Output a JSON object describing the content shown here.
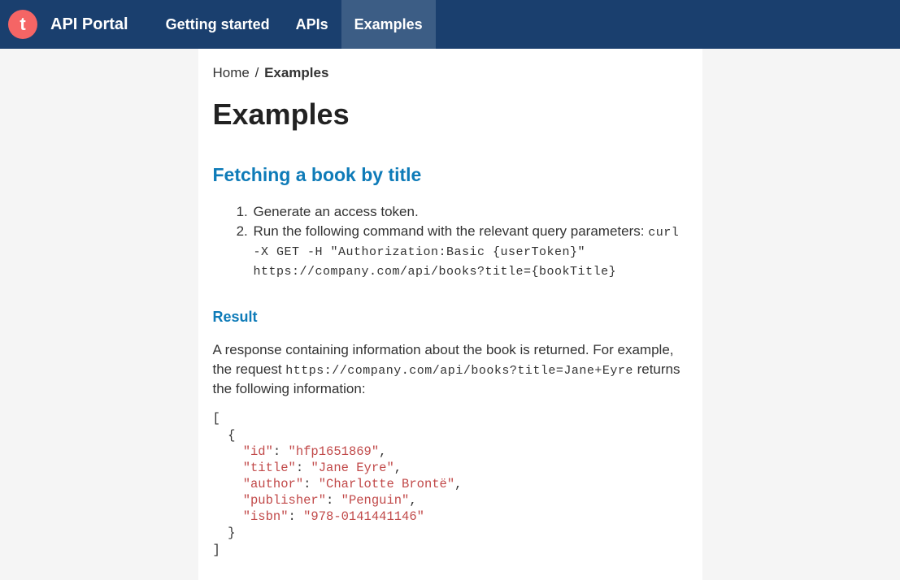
{
  "header": {
    "logo_letter": "t",
    "brand": "API Portal",
    "nav": [
      {
        "label": "Getting started",
        "active": false
      },
      {
        "label": "APIs",
        "active": false
      },
      {
        "label": "Examples",
        "active": true
      }
    ]
  },
  "breadcrumb": {
    "home": "Home",
    "sep": "/",
    "current": "Examples"
  },
  "page_title": "Examples",
  "section1": {
    "heading": "Fetching a book by title",
    "step1": "Generate an access token.",
    "step2_text": "Run the following command with the relevant query parameters: ",
    "step2_code": "curl -X GET -H \"Authorization:Basic {userToken}\" https://company.com/api/books?title={bookTitle}"
  },
  "result": {
    "heading": "Result",
    "description_pre": "A response containing information about the book is returned. For example, the request ",
    "description_code": "https://company.com/api/books?title=Jane+Eyre",
    "description_post": " returns the following information:",
    "json": {
      "open_bracket": "[",
      "open_brace": "  {",
      "line1_key": "    \"id\"",
      "line1_colon": ": ",
      "line1_val": "\"hfp1651869\"",
      "line1_comma": ",",
      "line2_key": "    \"title\"",
      "line2_val": "\"Jane Eyre\"",
      "line3_key": "    \"author\"",
      "line3_val": "\"Charlotte Brontë\"",
      "line4_key": "    \"publisher\"",
      "line4_val": "\"Penguin\"",
      "line5_key": "    \"isbn\"",
      "line5_val": "\"978-0141441146\"",
      "close_brace": "  }",
      "close_bracket": "]"
    }
  }
}
